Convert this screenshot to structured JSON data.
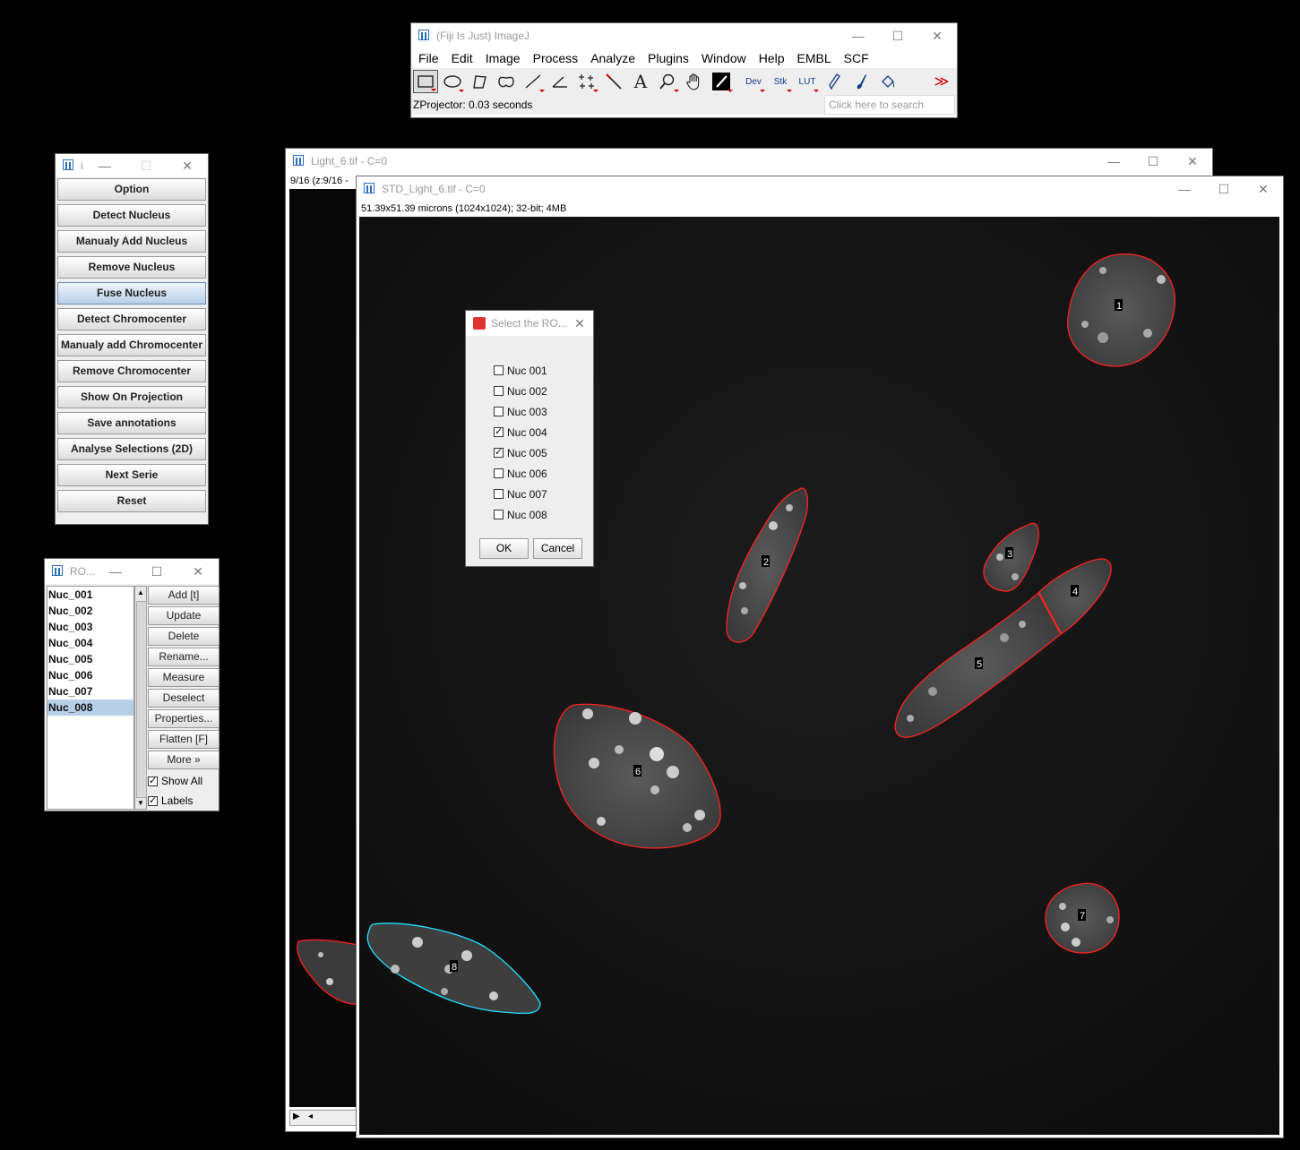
{
  "imagej": {
    "title": "(Fiji Is Just) ImageJ",
    "menu": [
      "File",
      "Edit",
      "Image",
      "Process",
      "Analyze",
      "Plugins",
      "Window",
      "Help",
      "EMBL",
      "SCF"
    ],
    "tools": {
      "dev": "Dev",
      "stk": "Stk",
      "lut": "LUT",
      "more": "≫"
    },
    "status": "ZProjector: 0.03 seconds",
    "search_placeholder": "Click here to search"
  },
  "plugin_panel": {
    "title": "i.",
    "buttons": [
      "Option",
      "Detect Nucleus",
      "Manualy Add Nucleus",
      "Remove Nucleus",
      "Fuse Nucleus",
      "Detect Chromocenter",
      "Manualy add Chromocenter",
      "Remove Chromocenter",
      "Show On Projection",
      "Save annotations",
      "Analyse Selections (2D)",
      "Next Serie",
      "Reset"
    ]
  },
  "roi_manager": {
    "title": "RO...",
    "items": [
      "Nuc_001",
      "Nuc_002",
      "Nuc_003",
      "Nuc_004",
      "Nuc_005",
      "Nuc_006",
      "Nuc_007",
      "Nuc_008"
    ],
    "selected_index": 7,
    "buttons": [
      "Add [t]",
      "Update",
      "Delete",
      "Rename...",
      "Measure",
      "Deselect",
      "Properties...",
      "Flatten [F]",
      "More »"
    ],
    "show_all": "Show All",
    "labels": "Labels"
  },
  "light_window": {
    "title": "Light_6.tif - C=0",
    "subtitle": "9/16 (z:9/16 -"
  },
  "std_window": {
    "title": "STD_Light_6.tif - C=0",
    "subtitle": "51.39x51.39 microns (1024x1024); 32-bit; 4MB",
    "roi_labels": [
      "1",
      "2",
      "3",
      "4",
      "5",
      "6",
      "7",
      "8"
    ]
  },
  "dialog": {
    "title": "Select the RO...",
    "options": [
      {
        "label": "Nuc 001",
        "checked": false
      },
      {
        "label": "Nuc 002",
        "checked": false
      },
      {
        "label": "Nuc 003",
        "checked": false
      },
      {
        "label": "Nuc 004",
        "checked": true
      },
      {
        "label": "Nuc 005",
        "checked": true
      },
      {
        "label": "Nuc 006",
        "checked": false
      },
      {
        "label": "Nuc 007",
        "checked": false
      },
      {
        "label": "Nuc 008",
        "checked": false
      }
    ],
    "ok": "OK",
    "cancel": "Cancel"
  },
  "colors": {
    "roi": "#ff2020",
    "roi_selected": "#20e0ff"
  }
}
